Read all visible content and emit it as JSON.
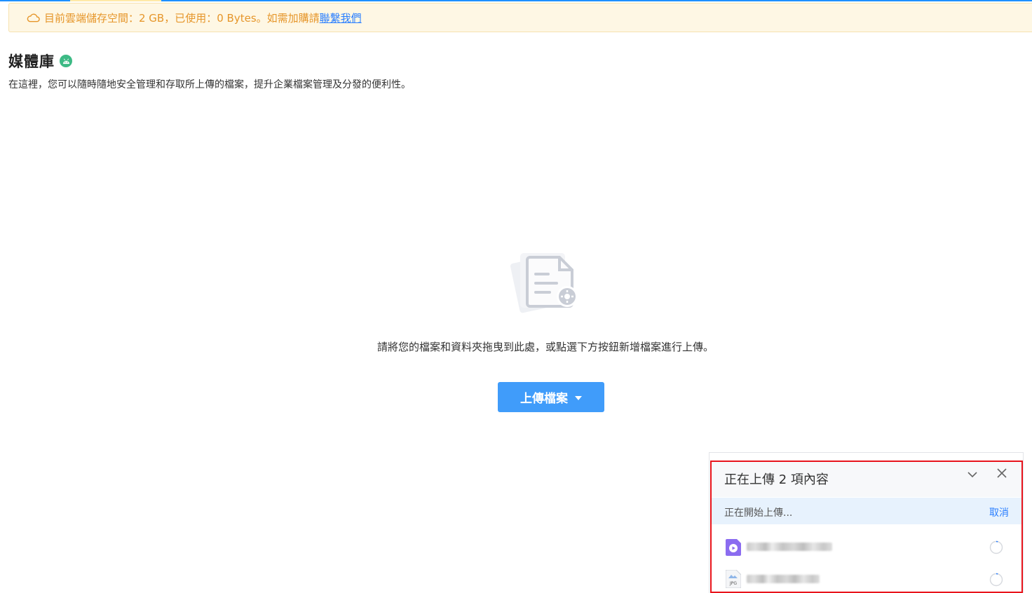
{
  "notice": {
    "icon": "cloud-icon",
    "text": "目前雲端儲存空間：2 GB，已使用：0 Bytes。如需加購請",
    "link_text": "聯繫我們"
  },
  "page": {
    "title": "媒體庫",
    "badge_icon": "android-icon",
    "subtitle": "在這裡，您可以隨時隨地安全管理和存取所上傳的檔案，提升企業檔案管理及分發的便利性。"
  },
  "empty_state": {
    "icon": "document-settings-icon",
    "text": "請將您的檔案和資料夾拖曳到此處，或點選下方按鈕新增檔案進行上傳。",
    "upload_button_label": "上傳檔案"
  },
  "upload_panel": {
    "title": "正在上傳 2 項內容",
    "status": "正在開始上傳...",
    "cancel_label": "取消",
    "files": [
      {
        "icon": "video-file-icon",
        "name": "",
        "state_icon": "loading-spinner-icon"
      },
      {
        "icon": "jpg-file-icon",
        "name": "",
        "state_icon": "loading-spinner-icon"
      }
    ]
  },
  "colors": {
    "accent": "#409cfa",
    "notice_text": "#e6962a",
    "link": "#2a7fff",
    "highlight_border": "#e8141c",
    "badge": "#3dba85"
  }
}
